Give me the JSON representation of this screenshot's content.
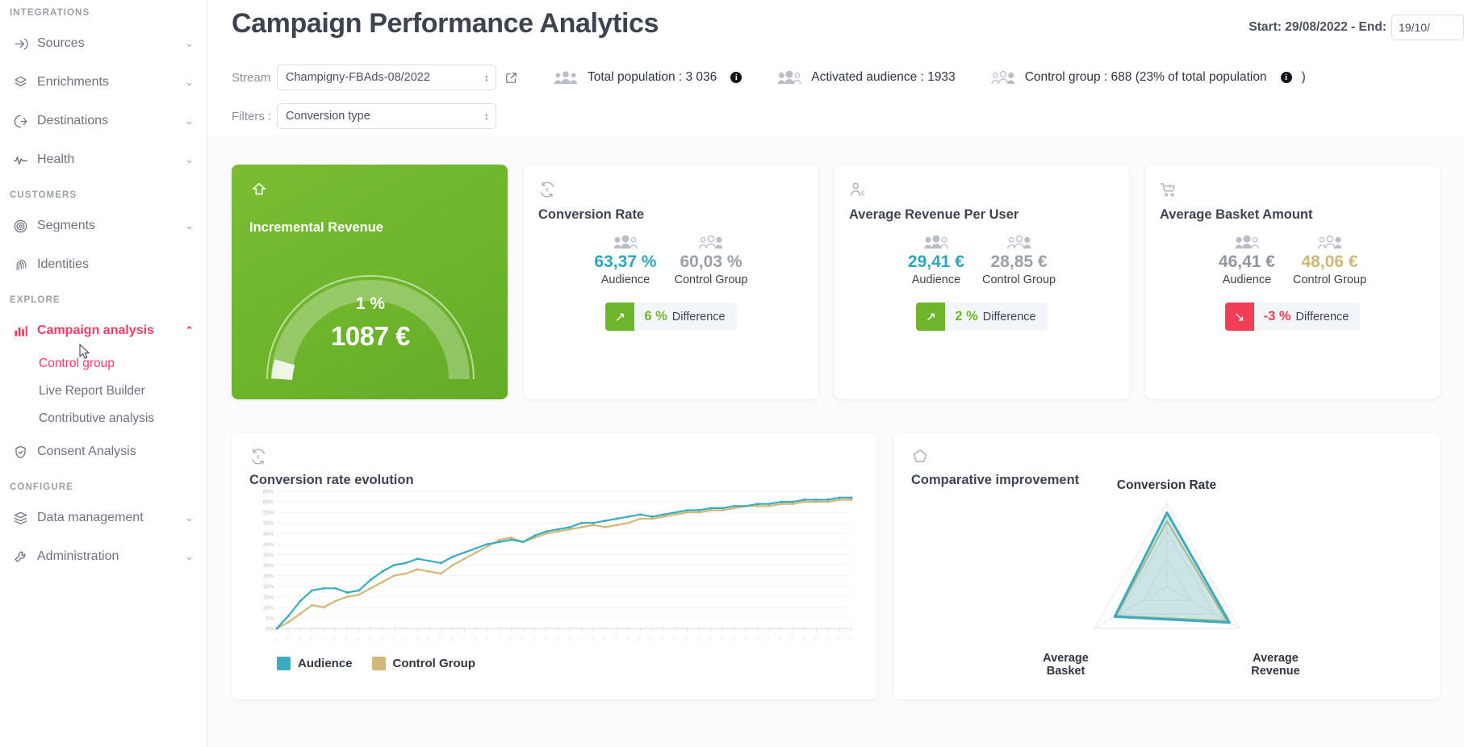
{
  "sidebar": {
    "sections": [
      {
        "label": "INTEGRATIONS"
      },
      {
        "label": "CUSTOMERS"
      },
      {
        "label": "EXPLORE"
      },
      {
        "label": "CONFIGURE"
      }
    ],
    "items": [
      {
        "label": "Sources",
        "icon": "sign-in-icon",
        "chevron": "⌄"
      },
      {
        "label": "Enrichments",
        "icon": "layers-icon",
        "chevron": "⌄"
      },
      {
        "label": "Destinations",
        "icon": "sign-out-icon",
        "chevron": "⌄"
      },
      {
        "label": "Health",
        "icon": "activity-pulse-icon",
        "chevron": "⌄"
      },
      {
        "label": "Segments",
        "icon": "target-icon",
        "chevron": "⌄"
      },
      {
        "label": "Identities",
        "icon": "fingerprint-icon",
        "chevron": ""
      },
      {
        "label": "Campaign analysis",
        "icon": "bar-chart-icon",
        "chevron": "⌃"
      },
      {
        "label": "Consent Analysis",
        "icon": "shield-check-icon",
        "chevron": ""
      },
      {
        "label": "Data management",
        "icon": "database-icon",
        "chevron": "⌄"
      },
      {
        "label": "Administration",
        "icon": "wrench-icon",
        "chevron": "⌄"
      }
    ],
    "sub_items": [
      {
        "label": "Control group"
      },
      {
        "label": "Live Report Builder"
      },
      {
        "label": "Contributive analysis"
      }
    ],
    "accent_color": "#ef3e66"
  },
  "header": {
    "title": "Campaign Performance Analytics",
    "date_prefix": "Start: 29/08/2022 - End:",
    "end_date_value": "19/10/"
  },
  "controls": {
    "stream_label": "Stream",
    "stream_value": "Champigny-FBAds-08/2022",
    "filters_label": "Filters :",
    "filter_value": "Conversion type",
    "external_link_icon": "external-link-icon",
    "stats": [
      {
        "icon": "group-filled-icon",
        "text": "Total population : 3 036",
        "info": "i"
      },
      {
        "icon": "group-partial-icon",
        "text": "Activated audience : 1933",
        "info": ""
      },
      {
        "icon": "group-outline-icon",
        "text": "Control group : 688 (23% of total population",
        "info": "i",
        "suffix": ")"
      }
    ]
  },
  "incremental": {
    "icon": "up-arrow-home-icon",
    "title": "Incremental Revenue",
    "percent": "1 %",
    "value": "1087 €"
  },
  "kpis": [
    {
      "icon": "conversion-refresh-euro-icon",
      "title": "Conversion Rate",
      "audience_value": "63,37 %",
      "audience_label": "Audience",
      "control_value": "60,03 %",
      "control_label": "Control Group",
      "diff_value": "6 %",
      "diff_label": "Difference",
      "direction": "up",
      "arrow": "↗",
      "audience_color": "#2aa7bd",
      "control_color": "#9aa0a8"
    },
    {
      "icon": "user-euro-icon",
      "title": "Average Revenue Per User",
      "audience_value": "29,41 €",
      "audience_label": "Audience",
      "control_value": "28,85 €",
      "control_label": "Control Group",
      "diff_value": "2 %",
      "diff_label": "Difference",
      "direction": "up",
      "arrow": "↗",
      "audience_color": "#2aa7bd",
      "control_color": "#9aa0a8"
    },
    {
      "icon": "shopping-cart-euro-icon",
      "title": "Average Basket Amount",
      "audience_value": "46,41 €",
      "audience_label": "Audience",
      "control_value": "48,06 €",
      "control_label": "Control Group",
      "diff_value": "-3 %",
      "diff_label": "Difference",
      "direction": "down",
      "arrow": "↘",
      "audience_color": "#8f959e",
      "control_color": "#cdb877"
    }
  ],
  "evolution_panel": {
    "icon": "conversion-refresh-euro-icon",
    "title": "Conversion rate evolution",
    "legend": [
      {
        "label": "Audience",
        "color": "#3aacbe"
      },
      {
        "label": "Control Group",
        "color": "#d2b878"
      }
    ]
  },
  "radar_panel": {
    "icon": "pentagon-icon",
    "title": "Comparative improvement",
    "axis_top": "Conversion Rate",
    "axis_left": "Average\nBasket",
    "axis_right": "Average\nRevenue"
  },
  "chart_data": [
    {
      "type": "line",
      "title": "Conversion rate evolution",
      "xlabel": "",
      "ylabel": "",
      "ylim": [
        0,
        65
      ],
      "yticks": [
        "0%",
        "5%",
        "10%",
        "15%",
        "20%",
        "25%",
        "30%",
        "35%",
        "40%",
        "45%",
        "50%",
        "55%",
        "60%",
        "65%"
      ],
      "grid": true,
      "legend_position": "bottom-left",
      "x": [
        1,
        2,
        3,
        4,
        5,
        6,
        7,
        8,
        9,
        10,
        11,
        12,
        13,
        14,
        15,
        16,
        17,
        18,
        19,
        20,
        21,
        22,
        23,
        24,
        25,
        26,
        27,
        28,
        29,
        30,
        31,
        32,
        33,
        34,
        35,
        36,
        37,
        38,
        39,
        40,
        41,
        42,
        43,
        44,
        45,
        46,
        47,
        48,
        49,
        50
      ],
      "series": [
        {
          "name": "Audience",
          "color": "#3aacbe",
          "values": [
            0,
            6,
            13,
            18,
            19,
            19,
            17,
            18,
            23,
            27,
            30,
            31,
            33,
            32,
            31,
            34,
            36,
            38,
            40,
            41,
            42,
            41,
            44,
            46,
            47,
            48,
            50,
            50,
            51,
            52,
            53,
            54,
            53,
            54,
            55,
            56,
            56,
            57,
            57,
            58,
            58,
            59,
            59,
            60,
            60,
            61,
            61,
            61,
            62,
            62
          ]
        },
        {
          "name": "Control Group",
          "color": "#d2b878",
          "values": [
            0,
            3,
            7,
            11,
            10,
            13,
            15,
            16,
            19,
            22,
            25,
            26,
            28,
            27,
            26,
            30,
            33,
            36,
            39,
            42,
            43,
            41,
            43,
            45,
            46,
            47,
            48,
            49,
            48,
            49,
            50,
            52,
            52,
            53,
            54,
            55,
            55,
            56,
            56,
            57,
            58,
            58,
            58,
            59,
            59,
            60,
            60,
            60,
            61,
            61
          ]
        }
      ]
    },
    {
      "type": "radar",
      "title": "Comparative improvement",
      "categories": [
        "Conversion Rate",
        "Average Revenue",
        "Average Basket"
      ],
      "max": 100,
      "series": [
        {
          "name": "Audience",
          "color": "#3aacbe",
          "values": [
            88,
            86,
            72
          ]
        },
        {
          "name": "Control Group",
          "color": "#d2b878",
          "values": [
            78,
            82,
            70
          ]
        }
      ]
    }
  ]
}
